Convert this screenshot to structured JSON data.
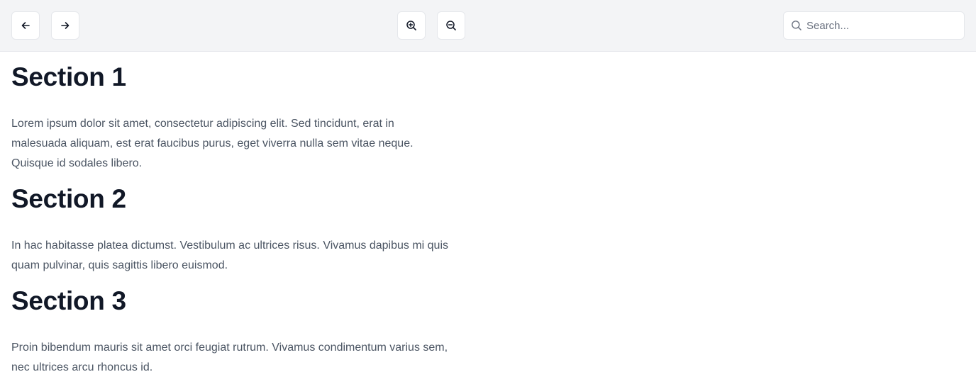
{
  "toolbar": {
    "back_icon": "arrow-left-icon",
    "forward_icon": "arrow-right-icon",
    "zoom_in_icon": "zoom-in-icon",
    "zoom_out_icon": "zoom-out-icon",
    "search": {
      "icon": "search-icon",
      "placeholder": "Search...",
      "value": ""
    }
  },
  "sections": [
    {
      "title": "Section 1",
      "body": "Lorem ipsum dolor sit amet, consectetur adipiscing elit. Sed tincidunt, erat in malesuada aliquam, est erat faucibus purus, eget viverra nulla sem vitae neque. Quisque id sodales libero."
    },
    {
      "title": "Section 2",
      "body": "In hac habitasse platea dictumst. Vestibulum ac ultrices risus. Vivamus dapibus mi quis quam pulvinar, quis sagittis libero euismod."
    },
    {
      "title": "Section 3",
      "body": "Proin bibendum mauris sit amet orci feugiat rutrum. Vivamus condimentum varius sem, nec ultrices arcu rhoncus id."
    }
  ],
  "colors": {
    "toolbar_bg": "#f3f4f6",
    "border": "#e5e7eb",
    "heading": "#111827",
    "body_text": "#4b5563"
  }
}
